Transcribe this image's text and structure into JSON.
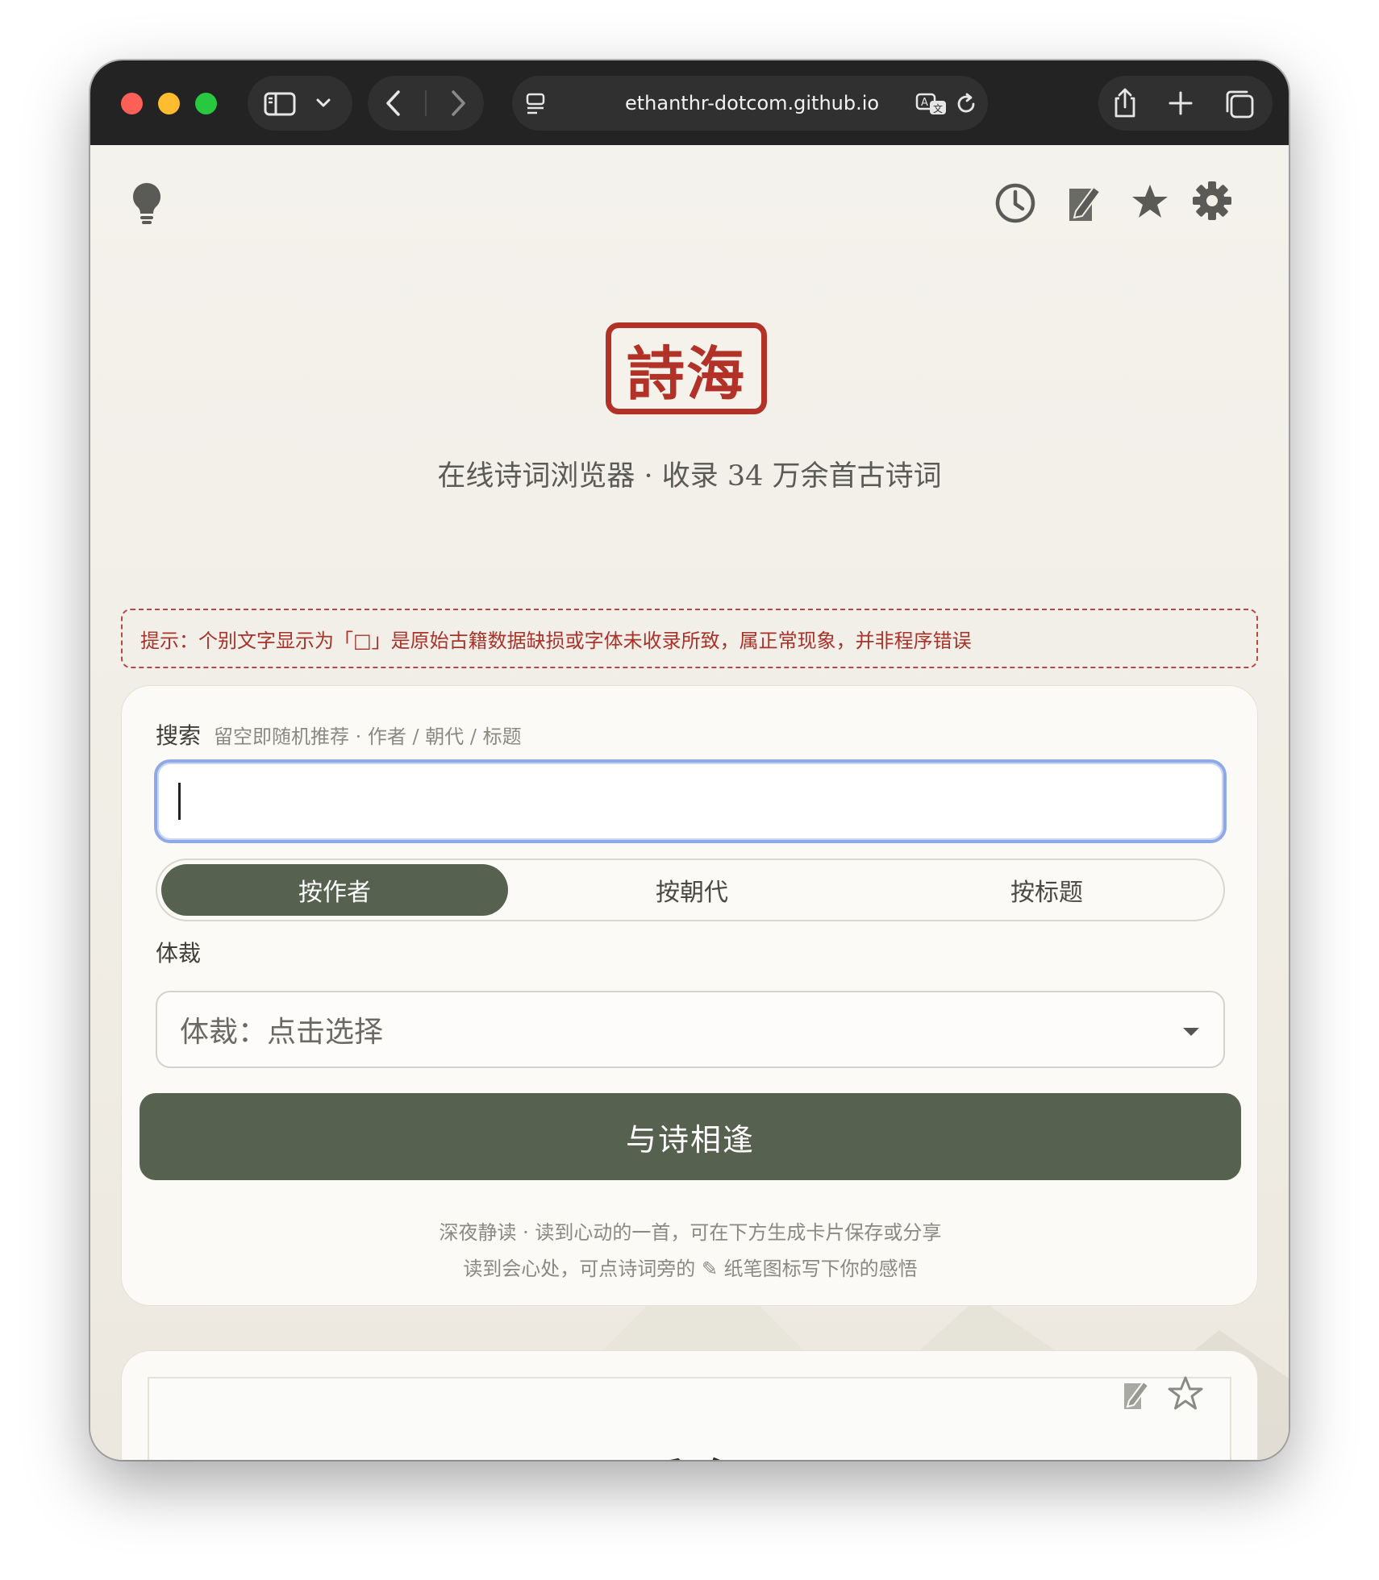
{
  "browser": {
    "url": "ethanthr-dotcom.github.io"
  },
  "app": {
    "logo_text": "詩海",
    "tagline": "在线诗词浏览器 · 收录 34 万余首古诗词",
    "notice": "提示：个别文字显示为「□」是原始古籍数据缺损或字体未收录所致，属正常现象，并非程序错误"
  },
  "search": {
    "label": "搜索",
    "hint": "留空即随机推荐 · 作者 / 朝代 / 标题",
    "value": "",
    "modes": [
      "按作者",
      "按朝代",
      "按标题"
    ],
    "active_mode": "按作者"
  },
  "genre": {
    "label": "体裁",
    "selected": "体裁：点击选择"
  },
  "submit_label": "与诗相逢",
  "help": {
    "line1": "深夜静读 · 读到心动的一首，可在下方生成卡片保存或分享",
    "line2": "读到会心处，可点诗词旁的 ✎ 纸笔图标写下你的感悟"
  },
  "poem": {
    "title": "雨后东园"
  },
  "colors": {
    "accent": "#566150",
    "seal_red": "#b33227",
    "notice_red": "#a8332b"
  }
}
